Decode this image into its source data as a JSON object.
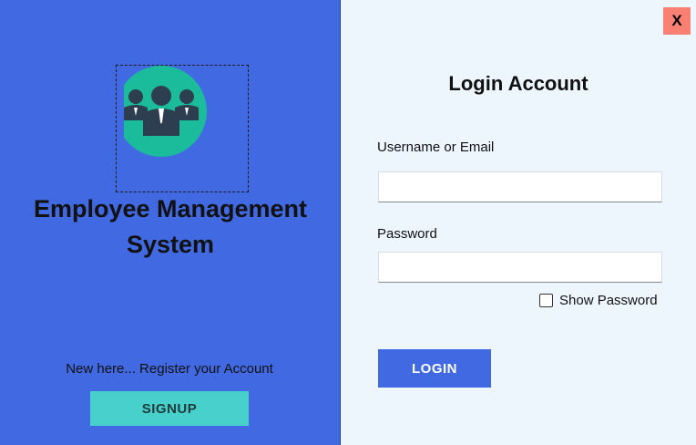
{
  "window": {
    "close_label": "X"
  },
  "left_panel": {
    "logo_icon": "employee-group-icon",
    "app_title": "Employee Management\nSystem",
    "register_prompt": "New here... Register your Account",
    "signup_label": "SIGNUP"
  },
  "login_form": {
    "title": "Login Account",
    "username_label": "Username or Email",
    "username_value": "",
    "password_label": "Password",
    "password_value": "",
    "show_password_label": "Show Password",
    "show_password_checked": false,
    "login_label": "LOGIN"
  },
  "colors": {
    "left_panel_bg": "#4169e1",
    "right_panel_bg": "#eef6fd",
    "signup_button": "#48d1cc",
    "login_button": "#4169e1",
    "close_button": "#f98072",
    "logo_circle": "#1abc9c",
    "logo_figures": "#2c3e50"
  }
}
